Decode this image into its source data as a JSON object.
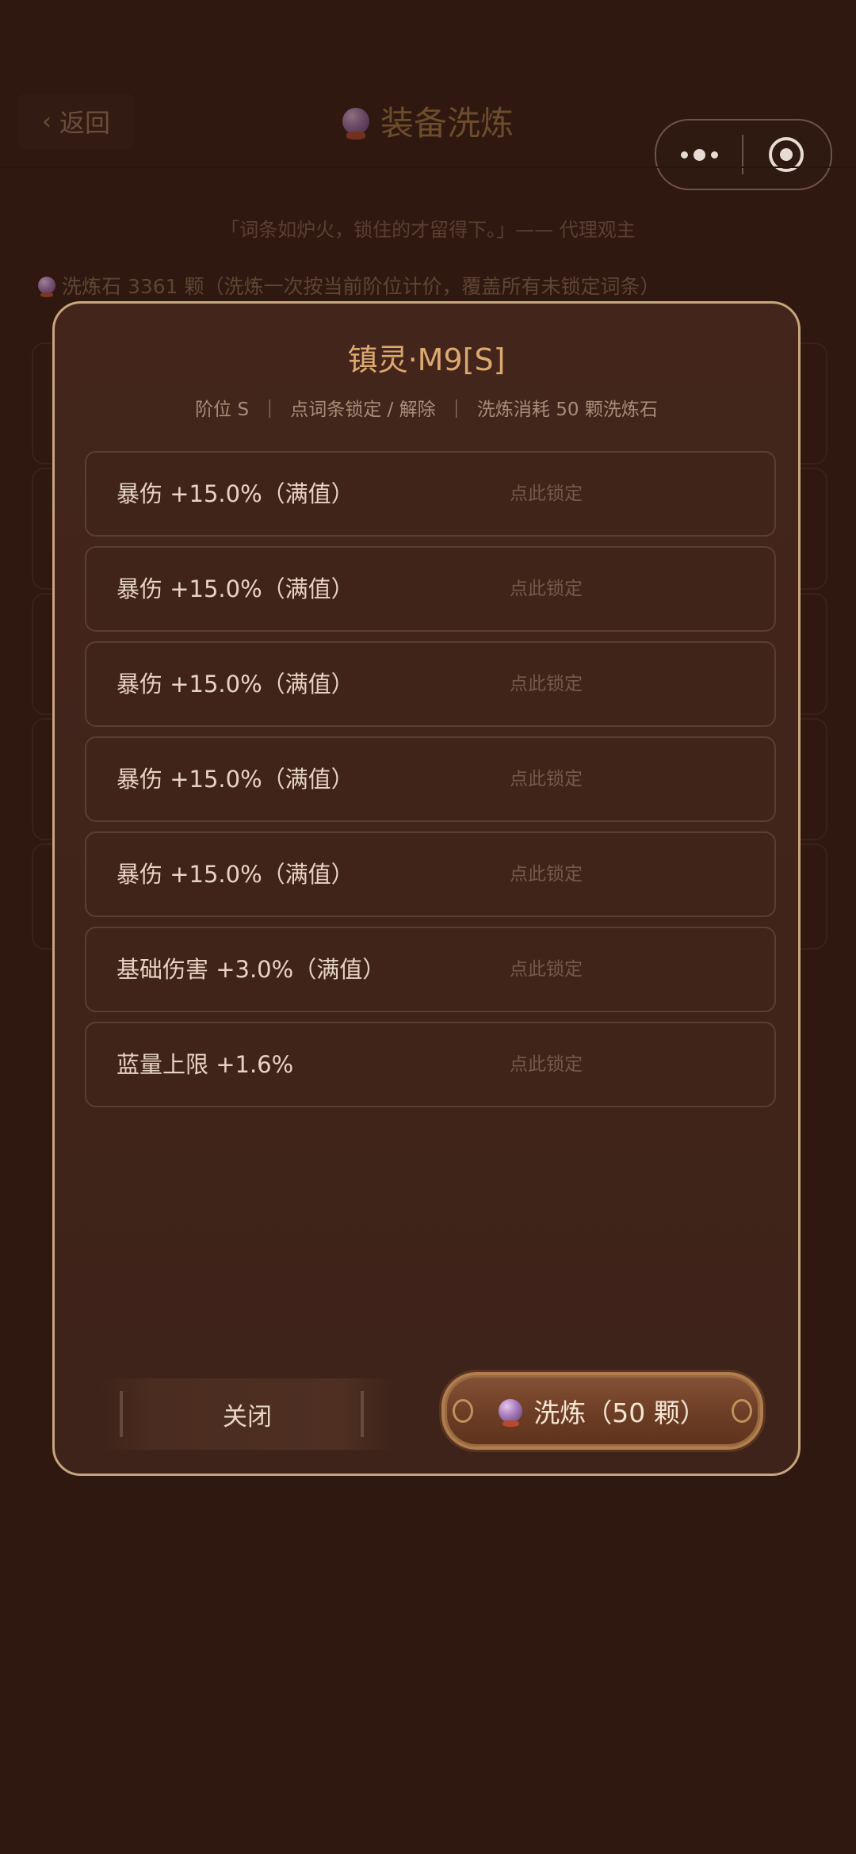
{
  "background": {
    "back_label": "返回",
    "page_title": "装备洗炼",
    "quote": "「词条如炉火，锁住的才留得下。」—— 代理观主",
    "stones_info": "洗炼石 3361 颗（洗炼一次按当前阶位计价，覆盖所有未锁定词条）"
  },
  "modal": {
    "title": "镇灵·M9[S]",
    "subtitle": "阶位 S  ｜  点词条锁定 / 解除  ｜  洗炼消耗 50 颗洗炼石",
    "lock_hint": "点此锁定",
    "affixes": [
      {
        "text": "暴伤 +15.0%（满值）"
      },
      {
        "text": "暴伤 +15.0%（满值）"
      },
      {
        "text": "暴伤 +15.0%（满值）"
      },
      {
        "text": "暴伤 +15.0%（满值）"
      },
      {
        "text": "暴伤 +15.0%（满值）"
      },
      {
        "text": "基础伤害 +3.0%（满值）"
      },
      {
        "text": "蓝量上限 +1.6%"
      }
    ],
    "close_label": "关闭",
    "wash_label": "洗炼（50 颗）"
  },
  "icons": {
    "back": "chevron-left-icon",
    "stone": "crystal-orb-icon",
    "more": "more-dots-icon",
    "target": "target-circle-icon"
  },
  "colors": {
    "accent": "#dca970",
    "modal_border": "#c8a57e",
    "background": "#2e1810"
  }
}
